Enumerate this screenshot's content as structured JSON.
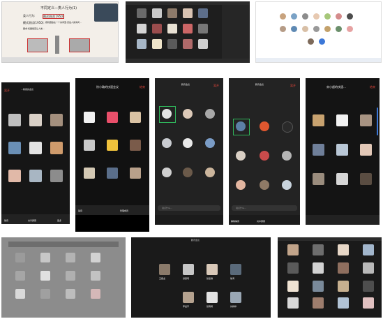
{
  "colors": {
    "accent_red": "#e0453a",
    "dark_bg": "#161616",
    "panel_bg": "#222222",
    "highlight_green": "#2fb35a",
    "slide_bg": "#f3efe9"
  },
  "top_left": {
    "slide_title": "不同定义—类人行为(1)",
    "line1_label": "类人行为:",
    "line1_value": "图灵测试(1950)",
    "line2_label": "模式测试(1950):",
    "line2_rest": "把机器放在一个房间里,然后人类询问…",
    "line3": "要求:机器能否让人类…"
  },
  "m1": {
    "leave": "离开",
    "title": "…教授的会议",
    "speaker_view": "演讲者视图",
    "bottom_labels": [
      "静音",
      "开启视频",
      "共享屏幕",
      "管理成员",
      "更多"
    ]
  },
  "m2": {
    "title": "徐小璐的快速会议",
    "leave": "结束",
    "bottom_labels": [
      "静音",
      "开启视频",
      "共享屏幕",
      "管理成员",
      "更多"
    ]
  },
  "m3": {
    "title": "腾讯会议",
    "leave": "离开",
    "input_placeholder": "说点什么…"
  },
  "m4": {
    "title": "腾讯会议",
    "leave": "离开",
    "input_placeholder": "说点什么…",
    "bottom_labels": [
      "解除静音",
      "开启视频",
      "共享屏幕",
      "管理成员",
      "更多"
    ]
  },
  "m5": {
    "title": "宋小超的快速…",
    "leave": "结束"
  },
  "bottom_mid": {
    "title": "腾讯会议",
    "names": [
      "王霞龙",
      "谭颖玥",
      "张嘉琪",
      "徐海",
      "何立东",
      "李晨宇",
      "张雨桐",
      "刘婷婷"
    ]
  }
}
